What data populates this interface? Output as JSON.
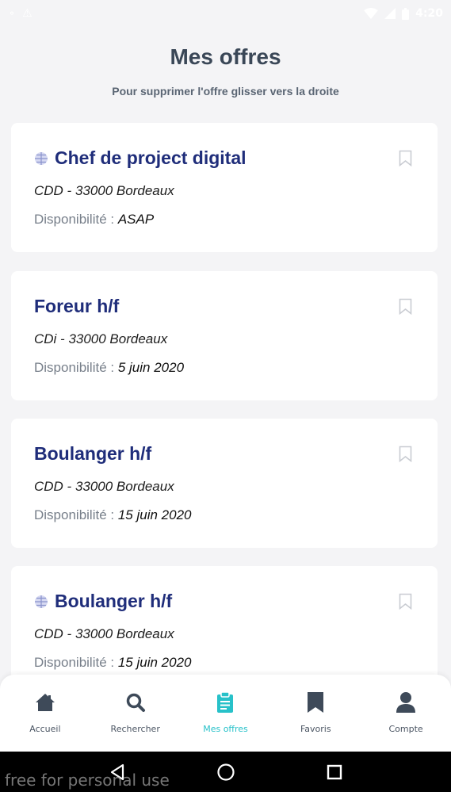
{
  "status_bar": {
    "time": "4:20"
  },
  "header": {
    "title": "Mes offres",
    "subtitle": "Pour supprimer l'offre glisser vers la droite"
  },
  "offers": [
    {
      "title": "Chef de project digital",
      "contract": "CDD - 33000 Bordeaux",
      "availability_label": "Disponibilité :",
      "availability_value": "ASAP",
      "has_globe": true
    },
    {
      "title": "Foreur h/f",
      "contract": "CDi - 33000 Bordeaux",
      "availability_label": "Disponibilité :",
      "availability_value": "5 juin 2020",
      "has_globe": false
    },
    {
      "title": "Boulanger h/f",
      "contract": "CDD - 33000 Bordeaux",
      "availability_label": "Disponibilité :",
      "availability_value": "15 juin 2020",
      "has_globe": false
    },
    {
      "title": "Boulanger h/f",
      "contract": "CDD - 33000 Bordeaux",
      "availability_label": "Disponibilité :",
      "availability_value": "15 juin 2020",
      "has_globe": true
    }
  ],
  "tabs": [
    {
      "label": "Accueil",
      "icon": "home-icon",
      "active": false
    },
    {
      "label": "Rechercher",
      "icon": "search-icon",
      "active": false
    },
    {
      "label": "Mes offres",
      "icon": "clipboard-icon",
      "active": true
    },
    {
      "label": "Favoris",
      "icon": "bookmark-icon",
      "active": false
    },
    {
      "label": "Compte",
      "icon": "user-icon",
      "active": false
    }
  ],
  "nav_bar": {
    "watermark": "free for personal use"
  },
  "colors": {
    "title": "#3a4757",
    "job_title": "#1f2d7a",
    "active_tab": "#27c1c9",
    "background": "#f4f4f6"
  }
}
